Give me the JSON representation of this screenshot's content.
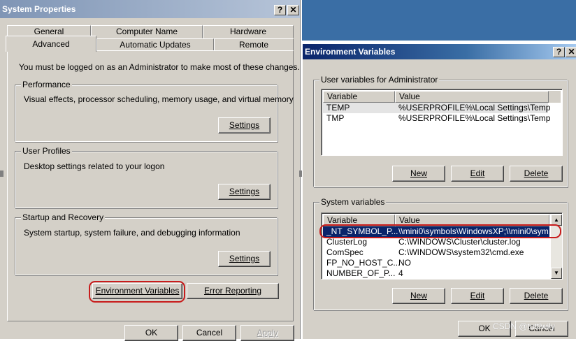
{
  "system_properties": {
    "title": "System Properties",
    "tabs_top": [
      "General",
      "Computer Name",
      "Hardware"
    ],
    "tabs_bottom": [
      "Advanced",
      "Automatic Updates",
      "Remote"
    ],
    "admin_note": "You must be logged on as an Administrator to make most of these changes.",
    "performance": {
      "title": "Performance",
      "desc": "Visual effects, processor scheduling, memory usage, and virtual memory",
      "button": "Settings"
    },
    "user_profiles": {
      "title": "User Profiles",
      "desc": "Desktop settings related to your logon",
      "button": "Settings"
    },
    "startup_recovery": {
      "title": "Startup and Recovery",
      "desc": "System startup, system failure, and debugging information",
      "button": "Settings"
    },
    "env_vars_button": "Environment Variables",
    "error_reporting_button": "Error Reporting",
    "ok": "OK",
    "cancel": "Cancel",
    "apply": "Apply",
    "help": "?",
    "close": "✕"
  },
  "environment_variables": {
    "title": "Environment Variables",
    "help": "?",
    "close": "✕",
    "user_group": "User variables for Administrator",
    "columns": [
      "Variable",
      "Value"
    ],
    "user_vars": [
      {
        "name": "TEMP",
        "value": "%USERPROFILE%\\Local Settings\\Temp"
      },
      {
        "name": "TMP",
        "value": "%USERPROFILE%\\Local Settings\\Temp"
      }
    ],
    "system_group": "System variables",
    "system_vars": [
      {
        "name": "_NT_SYMBOL_P...",
        "value": "\\\\mini0\\symbols\\WindowsXP;\\\\mini0\\sym..."
      },
      {
        "name": "ClusterLog",
        "value": "C:\\WINDOWS\\Cluster\\cluster.log"
      },
      {
        "name": "ComSpec",
        "value": "C:\\WINDOWS\\system32\\cmd.exe"
      },
      {
        "name": "FP_NO_HOST_C...",
        "value": "NO"
      },
      {
        "name": "NUMBER_OF_P...",
        "value": "4"
      }
    ],
    "new": "New",
    "edit": "Edit",
    "delete": "Delete",
    "ok": "OK",
    "cancel": "Cancel"
  },
  "watermark": "CSDN @tuttlwily"
}
